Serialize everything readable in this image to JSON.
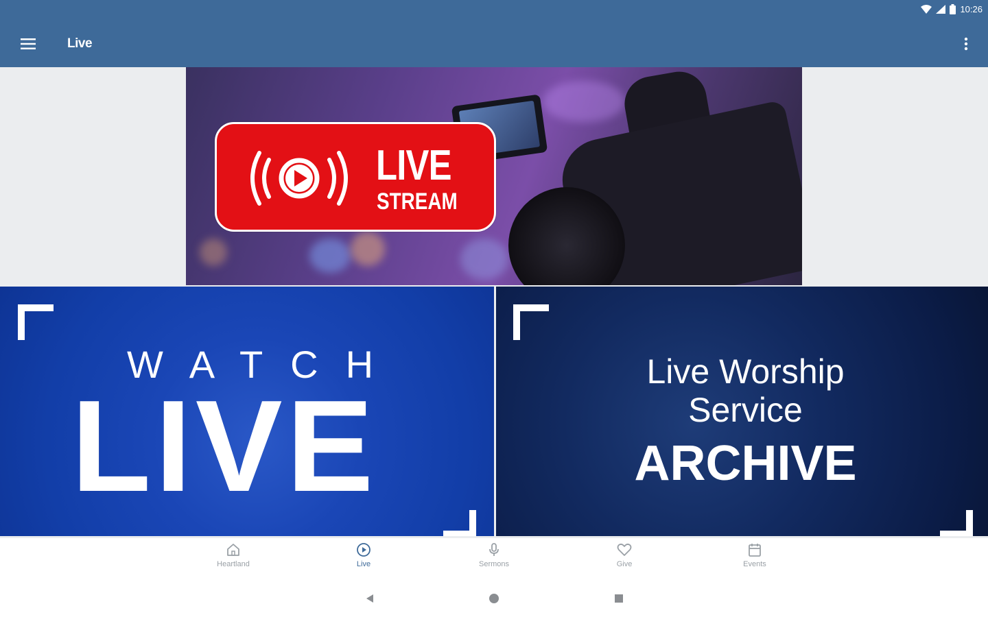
{
  "status_bar": {
    "time": "10:26",
    "icons": [
      "wifi-icon",
      "signal-icon",
      "battery-icon"
    ]
  },
  "app_bar": {
    "title": "Live",
    "menu_icon": "hamburger-menu-icon",
    "overflow_icon": "more-vert-icon"
  },
  "hero": {
    "badge_title": "LIVE",
    "badge_subtitle": "STREAM",
    "badge_color": "#e31015"
  },
  "tiles": {
    "watch": {
      "top_text": "WATCH",
      "main_text": "LIVE",
      "color": "#1a46b6"
    },
    "archive": {
      "line1": "Live Worship",
      "line2": "Service",
      "line3": "ARCHIVE",
      "color": "#0b1c47"
    }
  },
  "bottom_nav": {
    "active_color": "#3e6a99",
    "items": [
      {
        "label": "Heartland",
        "icon": "home-icon",
        "active": false
      },
      {
        "label": "Live",
        "icon": "play-circle-icon",
        "active": true
      },
      {
        "label": "Sermons",
        "icon": "microphone-icon",
        "active": false
      },
      {
        "label": "Give",
        "icon": "heart-icon",
        "active": false
      },
      {
        "label": "Events",
        "icon": "calendar-icon",
        "active": false
      }
    ]
  },
  "colors": {
    "app_bar": "#3e6a99"
  }
}
